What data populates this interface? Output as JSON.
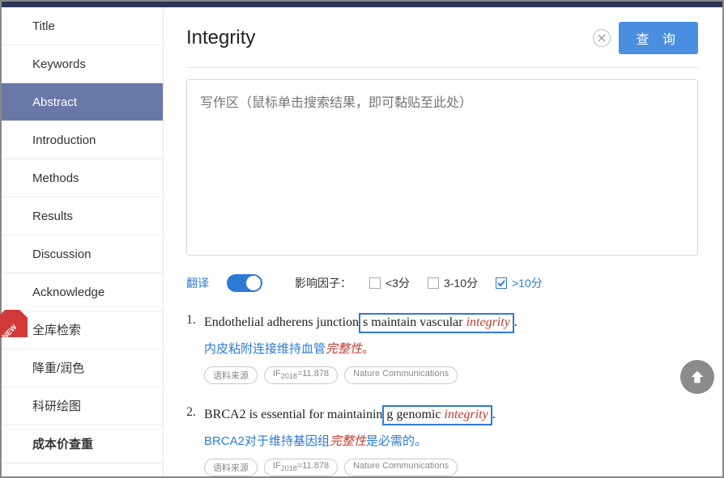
{
  "sidebar": {
    "items": [
      {
        "label": "Title"
      },
      {
        "label": "Keywords"
      },
      {
        "label": "Abstract"
      },
      {
        "label": "Introduction"
      },
      {
        "label": "Methods"
      },
      {
        "label": "Results"
      },
      {
        "label": "Discussion"
      },
      {
        "label": "Acknowledge"
      },
      {
        "label": "全库检索"
      },
      {
        "label": "降重/润色"
      },
      {
        "label": "科研绘图"
      },
      {
        "label": "成本价查重"
      }
    ]
  },
  "search": {
    "value": "Integrity",
    "button": "查 询"
  },
  "textarea": {
    "placeholder": "写作区（鼠标单击搜索结果，即可黏贴至此处）"
  },
  "filters": {
    "translate_label": "翻译",
    "if_label": "影响因子：",
    "opt1": "<3分",
    "opt2": "3-10分",
    "opt3": ">10分"
  },
  "results": [
    {
      "num": "1.",
      "pre": "Endothelial adherens junction",
      "boxed_pre": "s maintain vascular ",
      "boxed_kw": "integrity",
      "post": ".",
      "trans_pre": "内皮粘附连接维持血管",
      "trans_kw": "完整性",
      "trans_post": "。",
      "tag1": "语料来源",
      "tag2_pre": "IF",
      "tag2_sub": "2018",
      "tag2_val": "=11.878",
      "tag3": "Nature Communications"
    },
    {
      "num": "2.",
      "pre": "BRCA2 is essential for maintainin",
      "boxed_pre": "g genomic ",
      "boxed_kw": "integrity",
      "post": ".",
      "trans_pre": "BRCA2对于维持基因组",
      "trans_kw": "完整性",
      "trans_post": "是必需的。",
      "tag1": "语料来源",
      "tag2_pre": "IF",
      "tag2_sub": "2018",
      "tag2_val": "=11.878",
      "tag3": "Nature Communications"
    }
  ]
}
